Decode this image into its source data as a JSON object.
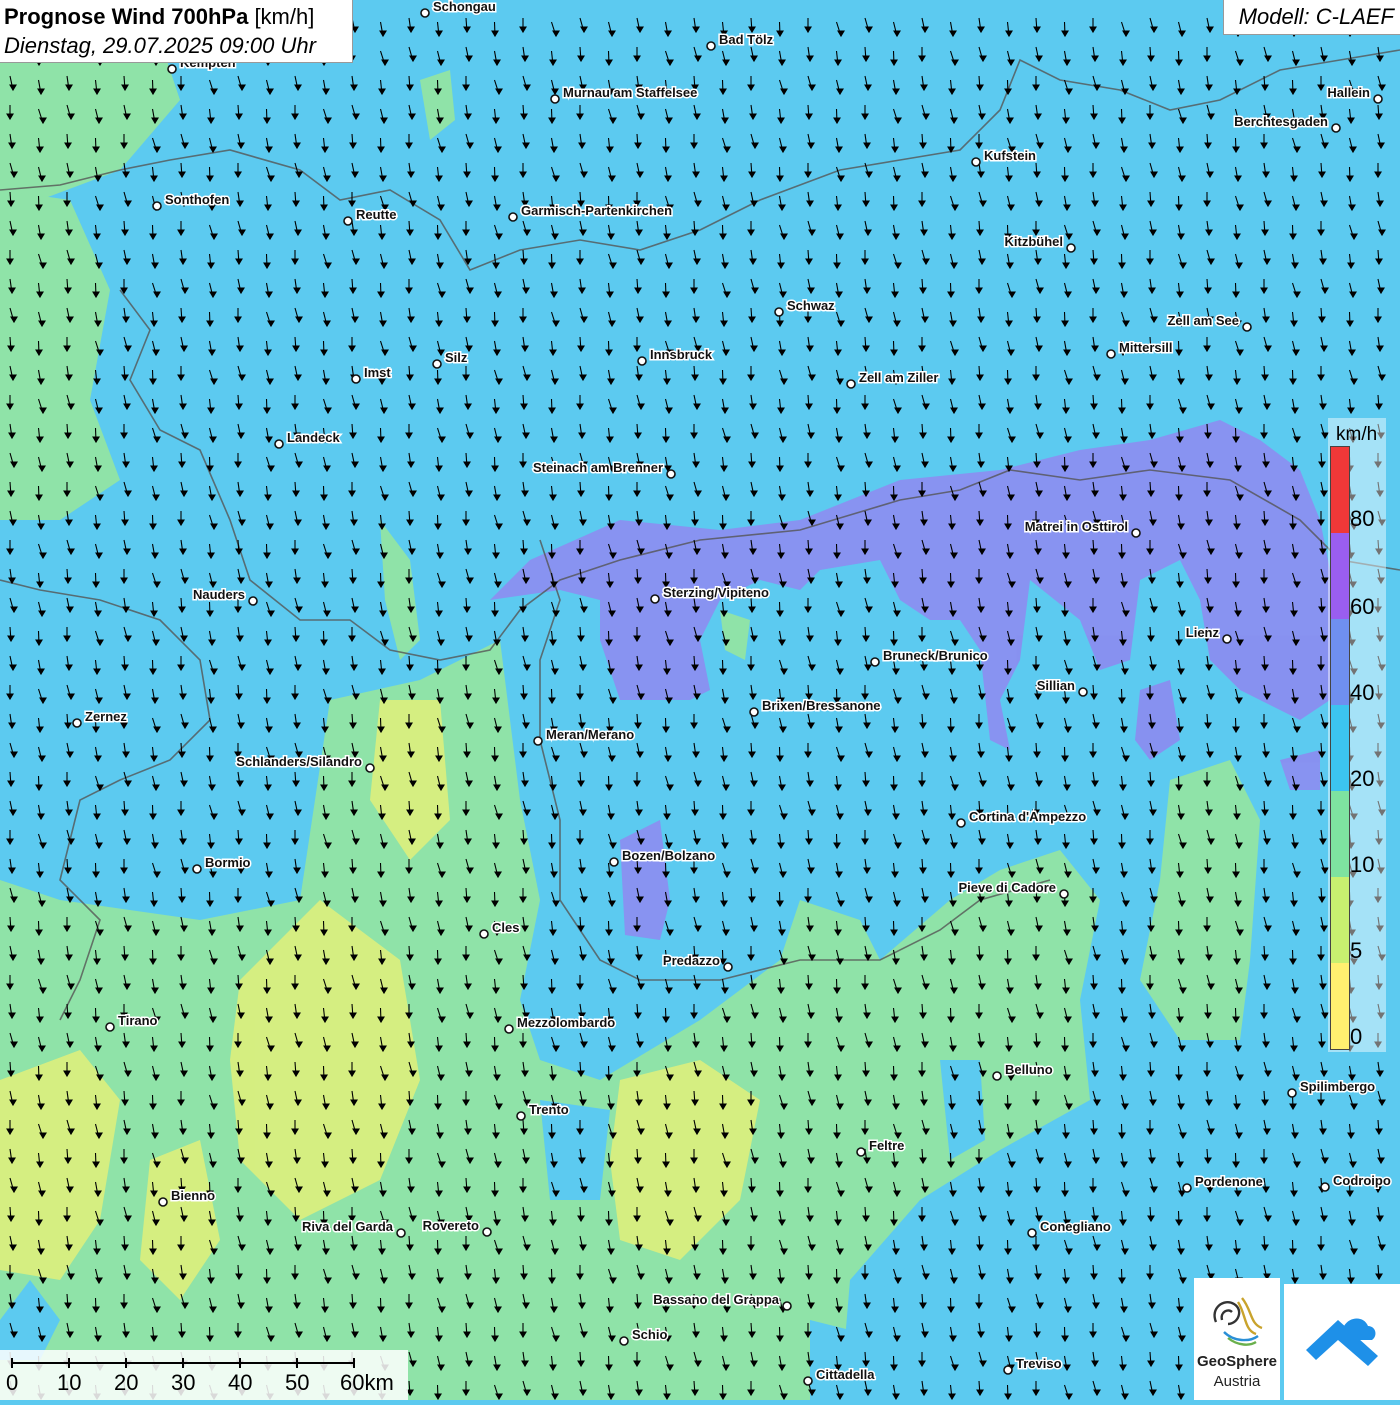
{
  "header": {
    "title_bold": "Prognose Wind 700hPa",
    "title_unit": "[km/h]",
    "date": "Dienstag, 29.07.2025 09:00 Uhr"
  },
  "model_label": "Modell: C-LAEF",
  "legend": {
    "unit": "km/h",
    "ticks": [
      "80",
      "60",
      "40",
      "20",
      "10",
      "5",
      "0"
    ],
    "classes": [
      {
        "from": 80,
        "color": "#f03838"
      },
      {
        "from": 60,
        "color": "#9a5ef0"
      },
      {
        "from": 40,
        "color": "#6f8ff0"
      },
      {
        "from": 20,
        "color": "#3cc4f0"
      },
      {
        "from": 10,
        "color": "#7ee3a0"
      },
      {
        "from": 5,
        "color": "#c8f070"
      },
      {
        "from": 0,
        "color": "#fff070"
      }
    ]
  },
  "scale_bar": {
    "labels": [
      "0",
      "10",
      "20",
      "30",
      "40",
      "50",
      "60km"
    ]
  },
  "cities": [
    {
      "name": "Schongau"
    },
    {
      "name": "Bad Tölz"
    },
    {
      "name": "Kempten"
    },
    {
      "name": "Murnau am Staffelsee"
    },
    {
      "name": "Hallein"
    },
    {
      "name": "Berchtesgaden"
    },
    {
      "name": "Kufstein"
    },
    {
      "name": "Sonthofen"
    },
    {
      "name": "Reutte"
    },
    {
      "name": "Garmisch-Partenkirchen"
    },
    {
      "name": "Kitzbühel"
    },
    {
      "name": "Schwaz"
    },
    {
      "name": "Zell am See"
    },
    {
      "name": "Mittersill"
    },
    {
      "name": "Innsbruck"
    },
    {
      "name": "Silz"
    },
    {
      "name": "Imst"
    },
    {
      "name": "Zell am Ziller"
    },
    {
      "name": "Landeck"
    },
    {
      "name": "Steinach am Brenner"
    },
    {
      "name": "Matrei in Osttirol"
    },
    {
      "name": "Nauders"
    },
    {
      "name": "Sterzing/Vipiteno"
    },
    {
      "name": "Lienz"
    },
    {
      "name": "Bruneck/Brunico"
    },
    {
      "name": "Sillian"
    },
    {
      "name": "Brixen/Bressanone"
    },
    {
      "name": "Zernez"
    },
    {
      "name": "Meran/Merano"
    },
    {
      "name": "Schlanders/Silandro"
    },
    {
      "name": "Cortina d'Ampezzo"
    },
    {
      "name": "Bozen/Bolzano"
    },
    {
      "name": "Bormio"
    },
    {
      "name": "Pieve di Cadore"
    },
    {
      "name": "Cles"
    },
    {
      "name": "Predazzo"
    },
    {
      "name": "Tirano"
    },
    {
      "name": "Mezzolombardo"
    },
    {
      "name": "Belluno"
    },
    {
      "name": "Spilimbergo"
    },
    {
      "name": "Trento"
    },
    {
      "name": "Feltre"
    },
    {
      "name": "Pordenone"
    },
    {
      "name": "Codroipo"
    },
    {
      "name": "Bienno"
    },
    {
      "name": "Riva del Garda"
    },
    {
      "name": "Rovereto"
    },
    {
      "name": "Conegliano"
    },
    {
      "name": "Bassano del Grappa"
    },
    {
      "name": "Schio"
    },
    {
      "name": "Treviso"
    },
    {
      "name": "Cittadella"
    }
  ],
  "logos": {
    "geosphere_line1": "GeoSphere",
    "geosphere_line2": "Austria"
  }
}
